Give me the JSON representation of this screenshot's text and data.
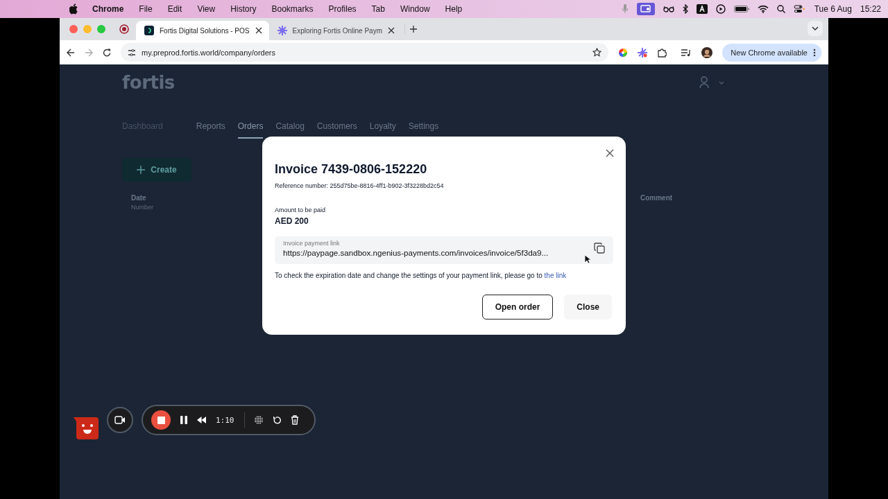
{
  "menubar": {
    "app": "Chrome",
    "items": [
      "File",
      "Edit",
      "View",
      "History",
      "Bookmarks",
      "Profiles",
      "Tab",
      "Window",
      "Help"
    ],
    "date": "Tue 6 Aug",
    "time": "15:22"
  },
  "browser": {
    "tabs": [
      {
        "title": "Fortis Digital Solutions - POS",
        "selected": true
      },
      {
        "title": "Exploring Fortis Online Paym",
        "selected": false
      }
    ],
    "url": "my.preprod.fortis.world/company/orders",
    "update_button": "New Chrome available"
  },
  "page": {
    "logo": "fortis",
    "nav": [
      {
        "label": "Dashboard",
        "selected": false,
        "disabled": true
      },
      {
        "label": "Reports",
        "selected": false,
        "disabled": false
      },
      {
        "label": "Orders",
        "selected": true,
        "disabled": false
      },
      {
        "label": "Catalog",
        "selected": false,
        "disabled": false
      },
      {
        "label": "Customers",
        "selected": false,
        "disabled": false
      },
      {
        "label": "Loyalty",
        "selected": false,
        "disabled": false
      },
      {
        "label": "Settings",
        "selected": false,
        "disabled": false
      }
    ],
    "create_button": "Create",
    "columns": [
      {
        "label": "Date",
        "sublabel": "Number"
      },
      {
        "label": "Comment"
      }
    ]
  },
  "dialog": {
    "title": "Invoice 7439-0806-152220",
    "reference": "Reference number: 255d75be-8816-4ff1-b902-3f3228bd2c54",
    "amount_label": "Amount to be paid",
    "amount": "AED 200",
    "link_label": "Invoice payment link",
    "link_value": "https://paypage.sandbox.ngenius-payments.com/invoices/invoice/5f3da9...",
    "note": "To check the expiration date and change the settings of your payment link, please go to",
    "note_link": "the link",
    "buttons": [
      {
        "label": "Open order",
        "kind": "outlined"
      },
      {
        "label": "Close",
        "kind": "plain"
      }
    ]
  },
  "recorder": {
    "time": "1:10"
  }
}
